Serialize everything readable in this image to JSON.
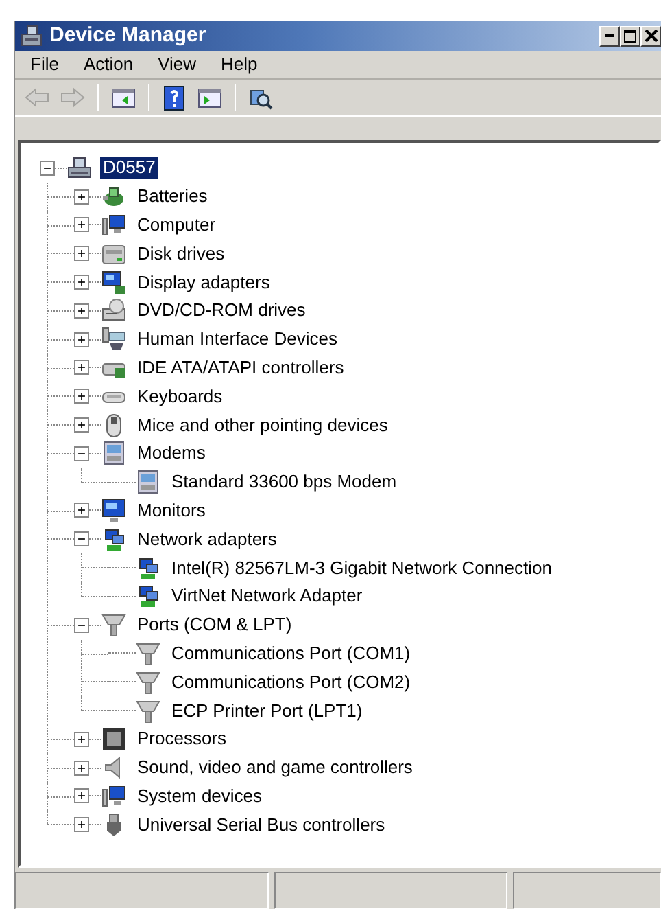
{
  "window": {
    "title": "Device Manager"
  },
  "menu": [
    "File",
    "Action",
    "View",
    "Help"
  ],
  "toolbar": [
    {
      "kind": "back",
      "disabled": true
    },
    {
      "kind": "forward",
      "disabled": true
    },
    {
      "kind": "separator"
    },
    {
      "kind": "pane",
      "disabled": false
    },
    {
      "kind": "separator"
    },
    {
      "kind": "help",
      "disabled": false
    },
    {
      "kind": "pane2",
      "disabled": false
    },
    {
      "kind": "separator"
    },
    {
      "kind": "scan",
      "disabled": false
    }
  ],
  "tree": [
    {
      "label": "D0557",
      "kind": "root",
      "selected": true,
      "expanded": true,
      "children": [
        {
          "label": "Batteries",
          "kind": "battery",
          "selected": false,
          "expanded": false
        },
        {
          "label": "Computer",
          "kind": "computer",
          "selected": false,
          "expanded": false
        },
        {
          "label": "Disk drives",
          "kind": "disk",
          "selected": false,
          "expanded": false
        },
        {
          "label": "Display adapters",
          "kind": "display",
          "selected": false,
          "expanded": false
        },
        {
          "label": "DVD/CD-ROM drives",
          "kind": "dvd",
          "selected": false,
          "expanded": false
        },
        {
          "label": "Human Interface Devices",
          "kind": "hid",
          "selected": false,
          "expanded": false
        },
        {
          "label": "IDE ATA/ATAPI controllers",
          "kind": "ide",
          "selected": false,
          "expanded": false
        },
        {
          "label": "Keyboards",
          "kind": "keyboard",
          "selected": false,
          "expanded": false
        },
        {
          "label": "Mice and other pointing devices",
          "kind": "mouse",
          "selected": false,
          "expanded": false
        },
        {
          "label": "Modems",
          "kind": "modem",
          "selected": false,
          "expanded": true,
          "children": [
            {
              "label": "Standard 33600 bps Modem",
              "kind": "modem",
              "selected": false
            }
          ]
        },
        {
          "label": "Monitors",
          "kind": "monitor",
          "selected": false,
          "expanded": false
        },
        {
          "label": "Network adapters",
          "kind": "network",
          "selected": false,
          "expanded": true,
          "children": [
            {
              "label": "Intel(R) 82567LM-3 Gigabit Network Connection",
              "kind": "network",
              "selected": false
            },
            {
              "label": "VirtNet Network Adapter",
              "kind": "network",
              "selected": false
            }
          ]
        },
        {
          "label": "Ports (COM & LPT)",
          "kind": "port",
          "selected": false,
          "expanded": true,
          "children": [
            {
              "label": "Communications Port (COM1)",
              "kind": "port",
              "selected": false
            },
            {
              "label": "Communications Port (COM2)",
              "kind": "port",
              "selected": false
            },
            {
              "label": "ECP Printer Port (LPT1)",
              "kind": "port",
              "selected": false
            }
          ]
        },
        {
          "label": "Processors",
          "kind": "processor",
          "selected": false,
          "expanded": false
        },
        {
          "label": "Sound, video and game controllers",
          "kind": "sound",
          "selected": false,
          "expanded": false
        },
        {
          "label": "System devices",
          "kind": "computer",
          "selected": false,
          "expanded": false
        },
        {
          "label": "Universal Serial Bus controllers",
          "kind": "usb",
          "selected": false,
          "expanded": false
        }
      ]
    }
  ]
}
